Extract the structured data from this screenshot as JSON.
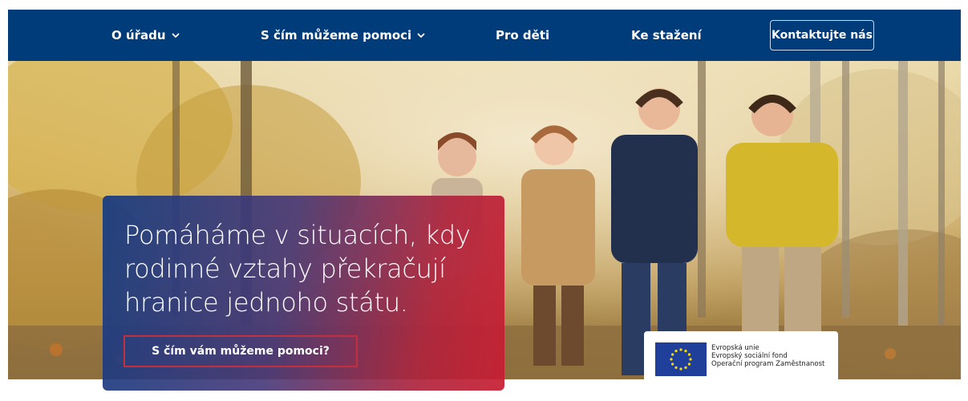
{
  "nav": {
    "items": [
      {
        "label": "O úřadu",
        "has_dropdown": true
      },
      {
        "label": "S čím můžeme pomoci",
        "has_dropdown": true
      },
      {
        "label": "Pro děti",
        "has_dropdown": false
      },
      {
        "label": "Ke stažení",
        "has_dropdown": false
      }
    ],
    "contact_label": "Kontaktujte nás"
  },
  "hero": {
    "headline": "Pomáháme v situacích, kdy rodinné vztahy překračují hranice jednoho státu.",
    "cta_label": "S čím vám můžeme pomoci?",
    "eu_badge": {
      "line1": "Evropská unie",
      "line2": "Evropský sociální fond",
      "line3": "Operační program Zaměstnanost"
    }
  },
  "colors": {
    "nav_bg": "#003c7a",
    "card_gradient_start": "#163c82",
    "card_gradient_end": "#c81e32",
    "eu_blue": "#1f3f9a",
    "eu_star": "#ffdd00"
  },
  "icons": {
    "dropdown": "chevron-down-icon",
    "eu_flag": "eu-flag-icon"
  }
}
